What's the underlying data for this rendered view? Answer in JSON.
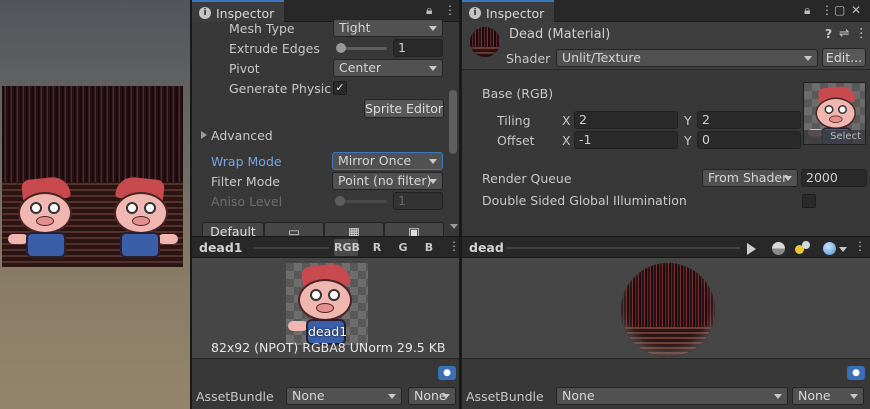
{
  "left_inspector": {
    "tab_title": "Inspector",
    "mesh_type": {
      "label": "Mesh Type",
      "value": "Tight"
    },
    "extrude_edges": {
      "label": "Extrude Edges",
      "value": "1"
    },
    "pivot": {
      "label": "Pivot",
      "value": "Center"
    },
    "generate_physics": {
      "label": "Generate Physics S",
      "checked": true
    },
    "sprite_editor_button": "Sprite Editor",
    "advanced": "Advanced",
    "wrap_mode": {
      "label": "Wrap Mode",
      "value": "Mirror Once"
    },
    "filter_mode": {
      "label": "Filter Mode",
      "value": "Point (no filter)"
    },
    "aniso_level": {
      "label": "Aniso Level",
      "value": "1"
    },
    "platform_tab": "Default",
    "preview": {
      "title": "dead1",
      "channels": [
        "RGB",
        "R",
        "G",
        "B"
      ],
      "asset_name": "dead1",
      "info": "82x92 (NPOT)  RGBA8 UNorm   29.5 KB"
    },
    "assetbundle": {
      "label": "AssetBundle",
      "name": "None",
      "variant": "None"
    }
  },
  "right_inspector": {
    "tab_title": "Inspector",
    "material_name": "Dead (Material)",
    "shader_label": "Shader",
    "shader_value": "Unlit/Texture",
    "edit_button": "Edit...",
    "base_label": "Base (RGB)",
    "tiling": {
      "label": "Tiling",
      "x": "2",
      "y": "2"
    },
    "offset": {
      "label": "Offset",
      "x": "-1",
      "y": "0"
    },
    "axis_x": "X",
    "axis_y": "Y",
    "select_button": "Select",
    "render_queue": {
      "label": "Render Queue",
      "mode": "From Shader",
      "value": "2000"
    },
    "double_sided_gi": {
      "label": "Double Sided Global Illumination",
      "checked": false
    },
    "preview": {
      "title": "dead"
    },
    "assetbundle": {
      "label": "AssetBundle",
      "name": "None",
      "variant": "None"
    }
  },
  "colors": {
    "accent": "#3a79bb",
    "panel": "#383838",
    "header": "#282828",
    "link_blue": "#74a6e4"
  },
  "icons": [
    "info-icon",
    "lock-icon",
    "kebab-menu-icon",
    "maximize-icon",
    "close-icon",
    "help-icon",
    "settings-sliders-icon",
    "play-icon",
    "sphere-icon",
    "lights-icon",
    "tag-icon",
    "fold-arrow-icon",
    "checkmark-icon"
  ]
}
